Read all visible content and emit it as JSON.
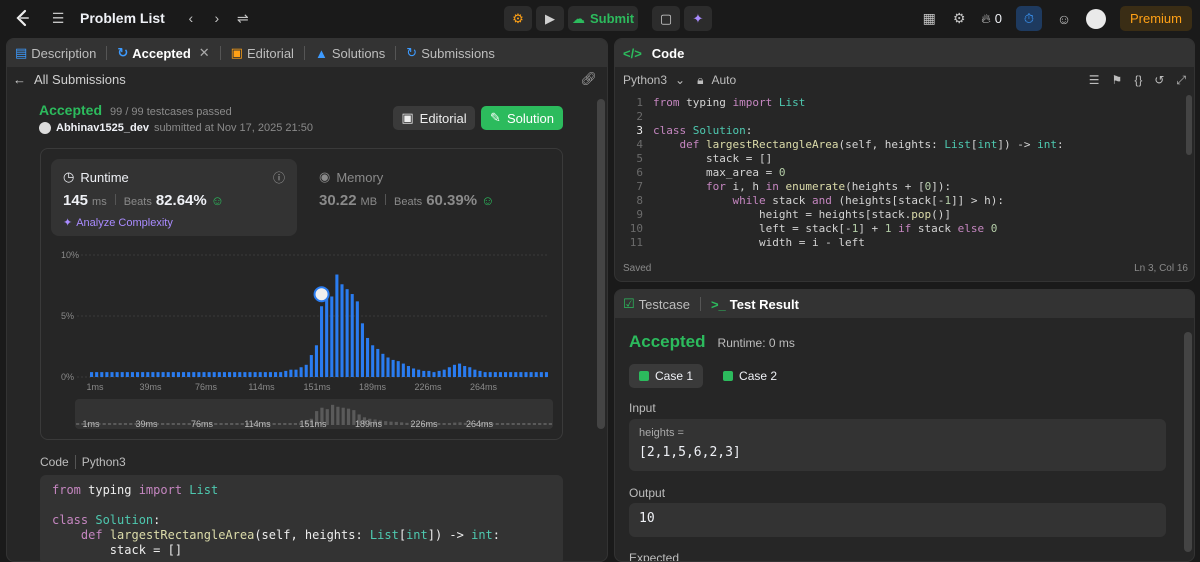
{
  "topbar": {
    "problem_list": "Problem List",
    "submit": "Submit",
    "fire_count": "0",
    "premium": "Premium"
  },
  "left_panel": {
    "tabs": [
      "Description",
      "Accepted",
      "Editorial",
      "Solutions",
      "Submissions"
    ],
    "all_submissions": "All Submissions",
    "status": "Accepted",
    "testcases": "99 / 99 testcases passed",
    "username": "Abhinav1525_dev",
    "submitted_at": "submitted at Nov 17, 2025 21:50",
    "editorial_btn": "Editorial",
    "solution_btn": "Solution",
    "runtime": {
      "label": "Runtime",
      "value": "145",
      "unit": "ms",
      "beats_label": "Beats",
      "beats": "82.64%",
      "analyze": "Analyze Complexity"
    },
    "memory": {
      "label": "Memory",
      "value": "30.22",
      "unit": "MB",
      "beats_label": "Beats",
      "beats": "60.39%"
    },
    "code_label": "Code",
    "code_lang": "Python3",
    "code_lines": [
      "from typing import List",
      "",
      "class Solution:",
      "    def largestRectangleArea(self, heights: List[int]) -> int:",
      "        stack = []"
    ]
  },
  "chart_data": {
    "type": "bar",
    "ylabel_ticks": [
      "10%",
      "5%",
      "0%"
    ],
    "ylim": [
      0,
      10
    ],
    "x_ticks": [
      "1ms",
      "39ms",
      "76ms",
      "114ms",
      "151ms",
      "189ms",
      "226ms",
      "264ms"
    ],
    "values": [
      0.4,
      0.4,
      0.4,
      0.4,
      0.4,
      0.4,
      0.4,
      0.4,
      0.4,
      0.4,
      0.4,
      0.4,
      0.4,
      0.4,
      0.4,
      0.4,
      0.4,
      0.4,
      0.4,
      0.4,
      0.4,
      0.4,
      0.4,
      0.4,
      0.4,
      0.4,
      0.4,
      0.4,
      0.4,
      0.4,
      0.4,
      0.4,
      0.4,
      0.4,
      0.4,
      0.4,
      0.4,
      0.4,
      0.5,
      0.6,
      0.6,
      0.8,
      1.0,
      1.8,
      2.6,
      5.8,
      7.2,
      6.6,
      8.4,
      7.6,
      7.2,
      6.8,
      6.2,
      4.4,
      3.2,
      2.6,
      2.3,
      1.9,
      1.6,
      1.4,
      1.3,
      1.1,
      0.9,
      0.7,
      0.6,
      0.5,
      0.5,
      0.4,
      0.5,
      0.6,
      0.8,
      1.0,
      1.1,
      0.9,
      0.8,
      0.6,
      0.5,
      0.4,
      0.4,
      0.4,
      0.4,
      0.4,
      0.4,
      0.4,
      0.4,
      0.4,
      0.4,
      0.4,
      0.4,
      0.4
    ],
    "highlight": "145ms",
    "range_ticks": [
      "1ms",
      "39ms",
      "76ms",
      "114ms",
      "151ms",
      "189ms",
      "226ms",
      "264ms"
    ]
  },
  "right_top": {
    "title": "Code",
    "lang": "Python3",
    "auto": "Auto",
    "lines": [
      "from typing import List",
      "",
      "class Solution:",
      "    def largestRectangleArea(self, heights: List[int]) -> int:",
      "        stack = []",
      "        max_area = 0",
      "        for i, h in enumerate(heights + [0]):",
      "            while stack and (heights[stack[-1]] > h):",
      "                height = heights[stack.pop()]",
      "                left = stack[-1] + 1 if stack else 0",
      "                width = i - left"
    ],
    "saved": "Saved",
    "position": "Ln 3, Col 16"
  },
  "right_bottom": {
    "tabs": [
      "Testcase",
      "Test Result"
    ],
    "status": "Accepted",
    "runtime": "Runtime: 0 ms",
    "cases": [
      "Case 1",
      "Case 2"
    ],
    "input_label": "Input",
    "input_var": "heights =",
    "input_value": "[2,1,5,6,2,3]",
    "output_label": "Output",
    "output_value": "10",
    "expected_label": "Expected"
  }
}
